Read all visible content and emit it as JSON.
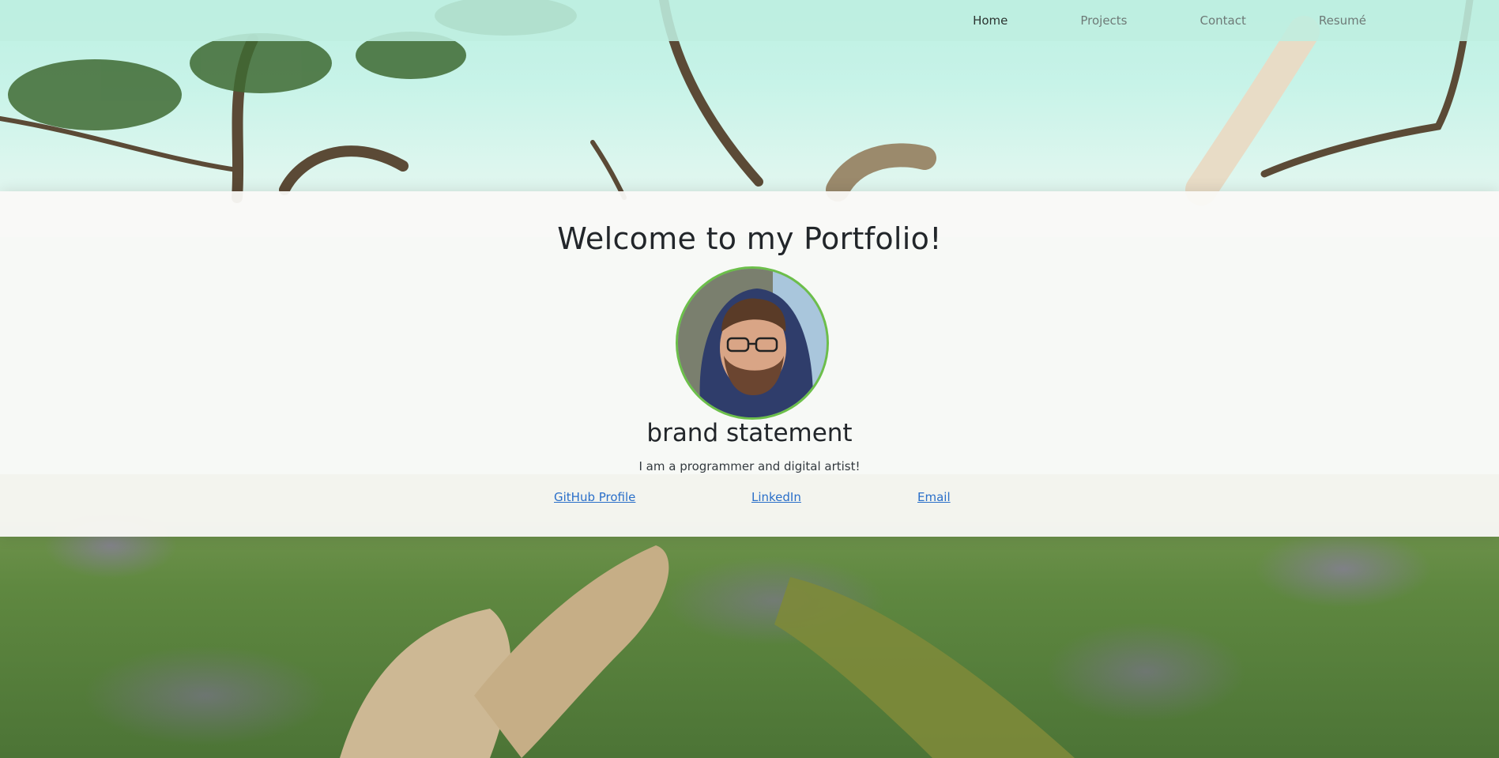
{
  "nav": {
    "items": [
      {
        "label": "Home",
        "active": true
      },
      {
        "label": "Projects",
        "active": false
      },
      {
        "label": "Contact",
        "active": false
      },
      {
        "label": "Resumé",
        "active": false
      }
    ]
  },
  "hero": {
    "title": "Welcome to my Portfolio!",
    "brand": "brand statement",
    "tagline": "I am a programmer and digital artist!",
    "links": {
      "github": "GitHub Profile",
      "linkedin": "LinkedIn",
      "email": "Email"
    }
  },
  "colors": {
    "nav_bg": "#beeee0",
    "link": "#2a6fc9",
    "avatar_border": "#6cbf4a",
    "text_dark": "#22262a"
  },
  "icons": {
    "avatar": "profile-photo"
  }
}
